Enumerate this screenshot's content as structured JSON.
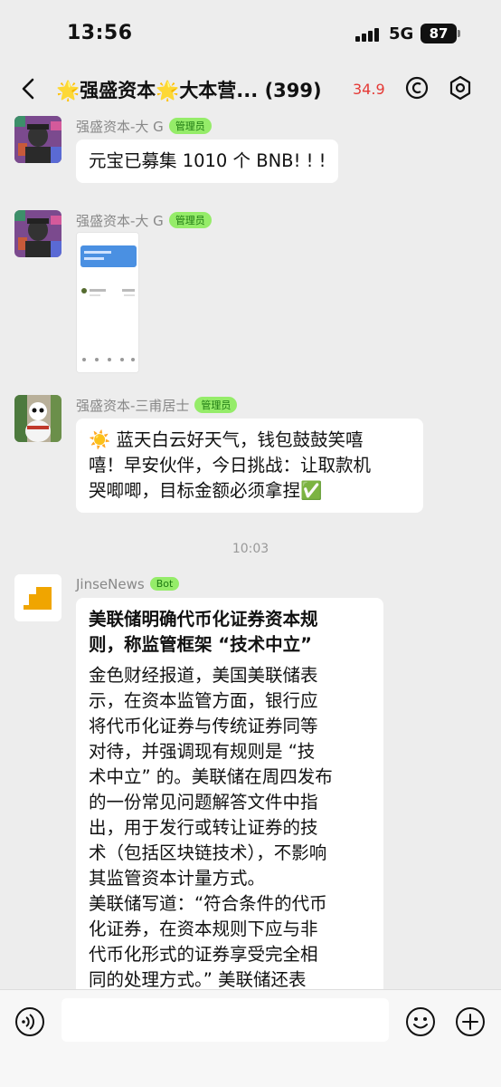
{
  "status_bar": {
    "time": "13:56",
    "network": "5G",
    "battery": "87"
  },
  "header": {
    "star_left": "🌟",
    "title_part1": "强盛资本",
    "star_mid": "🌟",
    "title_part2": "大本营...",
    "member_count": "(399)",
    "price": "34.93"
  },
  "messages": [
    {
      "sender": "强盛资本-大 G",
      "badge": "管理员",
      "text": "元宝已募集 1010 个 BNB! ! !"
    },
    {
      "sender": "强盛资本-大 G",
      "badge": "管理员",
      "image": "screenshot-image"
    },
    {
      "sender": "强盛资本-三甫居士",
      "badge": "管理员",
      "lines": [
        "☀️ 蓝天白云好天气，钱包鼓鼓笑嘻",
        "嘻！早安伙伴，今日挑战：让取款机",
        "哭唧唧，目标金额必须拿捏✅"
      ]
    },
    {
      "timestamp": "10:03"
    },
    {
      "sender": "JinseNews",
      "badge": "Bot",
      "headline": [
        "美联储明确代币化证券资本规",
        "则，称监管框架 “技术中立”"
      ],
      "body": [
        "金色财经报道，美国美联储表",
        "示，在资本监管方面，银行应",
        "将代币化证券与传统证券同等",
        "对待，并强调现有规则是 “技",
        "术中立” 的。美联储在周四发布",
        "的一份常见问题解答文件中指",
        "出，用于发行或转让证券的技",
        "术（包括区块链技术），不影响",
        "其监管资本计量方式。",
        "美联储写道：“符合条件的代币",
        "化证券，在资本规则下应与非",
        "代币化形式的证券享受完全相",
        "同的处理方式。” 美联储还表"
      ]
    }
  ],
  "colors": {
    "background": "#ededed",
    "badge": "#95ec69",
    "price": "#e53935",
    "jinse_logo": "#f0a500"
  }
}
